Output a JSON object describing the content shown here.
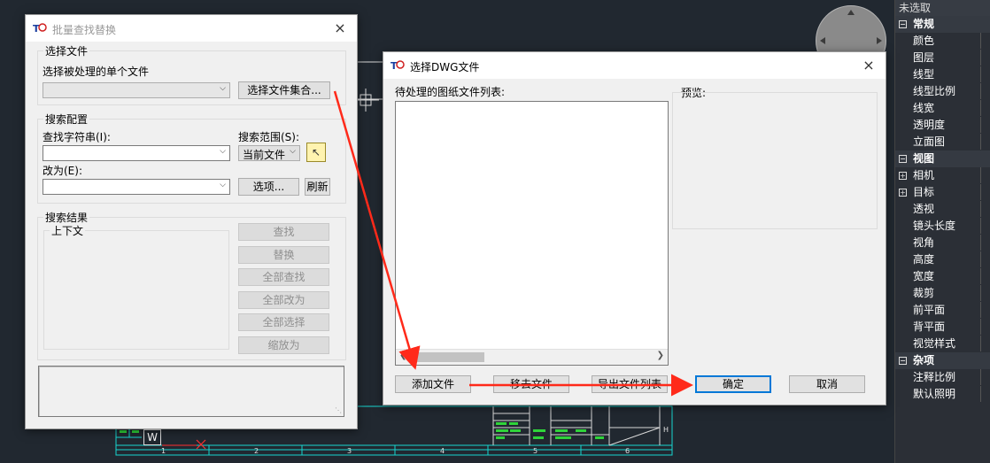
{
  "colors": {
    "cad_background": "#212830",
    "accent": "#0078d7",
    "arrow": "#ff2a1a",
    "cad_cyan": "#18d6d0",
    "cad_green": "#2fd43a"
  },
  "dialog_batch": {
    "title": "批量查找替换",
    "close_icon": "×",
    "select_file_group": {
      "title": "选择文件",
      "single_file_label": "选择被处理的单个文件",
      "single_file_value": "",
      "select_set_button": "选择文件集合..."
    },
    "search_config_group": {
      "title": "搜索配置",
      "find_label": "查找字符串(I):",
      "find_value": "",
      "scope_label": "搜索范围(S):",
      "scope_value": "当前文件",
      "replace_label": "改为(E):",
      "replace_value": "",
      "options_button": "选项...",
      "refresh_button": "刷新"
    },
    "results_group": {
      "title": "搜索结果",
      "context_label": "上下文",
      "buttons": [
        "查找",
        "替换",
        "全部查找",
        "全部改为",
        "全部选择",
        "缩放为"
      ]
    }
  },
  "dialog_dwg": {
    "title": "选择DWG文件",
    "close_icon": "×",
    "list_label": "待处理的图纸文件列表:",
    "preview_label": "预览:",
    "add_button": "添加文件",
    "remove_button": "移去文件",
    "export_button": "导出文件列表",
    "ok_button": "确定",
    "cancel_button": "取消"
  },
  "properties_panel": {
    "selection": "未选取",
    "rows": [
      {
        "type": "cat",
        "label": "常规"
      },
      {
        "type": "prop",
        "label": "颜色"
      },
      {
        "type": "prop",
        "label": "图层"
      },
      {
        "type": "prop",
        "label": "线型"
      },
      {
        "type": "prop",
        "label": "线型比例"
      },
      {
        "type": "prop",
        "label": "线宽"
      },
      {
        "type": "prop",
        "label": "透明度"
      },
      {
        "type": "prop",
        "label": "立面图"
      },
      {
        "type": "cat",
        "label": "视图"
      },
      {
        "type": "sub",
        "label": "相机"
      },
      {
        "type": "sub",
        "label": "目标"
      },
      {
        "type": "prop",
        "label": "透视"
      },
      {
        "type": "prop",
        "label": "镜头长度"
      },
      {
        "type": "prop",
        "label": "视角"
      },
      {
        "type": "prop",
        "label": "高度"
      },
      {
        "type": "prop",
        "label": "宽度"
      },
      {
        "type": "prop",
        "label": "裁剪"
      },
      {
        "type": "prop",
        "label": "前平面"
      },
      {
        "type": "prop",
        "label": "背平面"
      },
      {
        "type": "prop",
        "label": "视觉样式"
      },
      {
        "type": "cat",
        "label": "杂项"
      },
      {
        "type": "prop",
        "label": "注释比例"
      },
      {
        "type": "prop",
        "label": "默认照明"
      }
    ]
  },
  "cad": {
    "w_label": "W",
    "grid_numbers": [
      "1",
      "2",
      "3",
      "4",
      "5",
      "6"
    ],
    "grid_row_label": "H"
  }
}
